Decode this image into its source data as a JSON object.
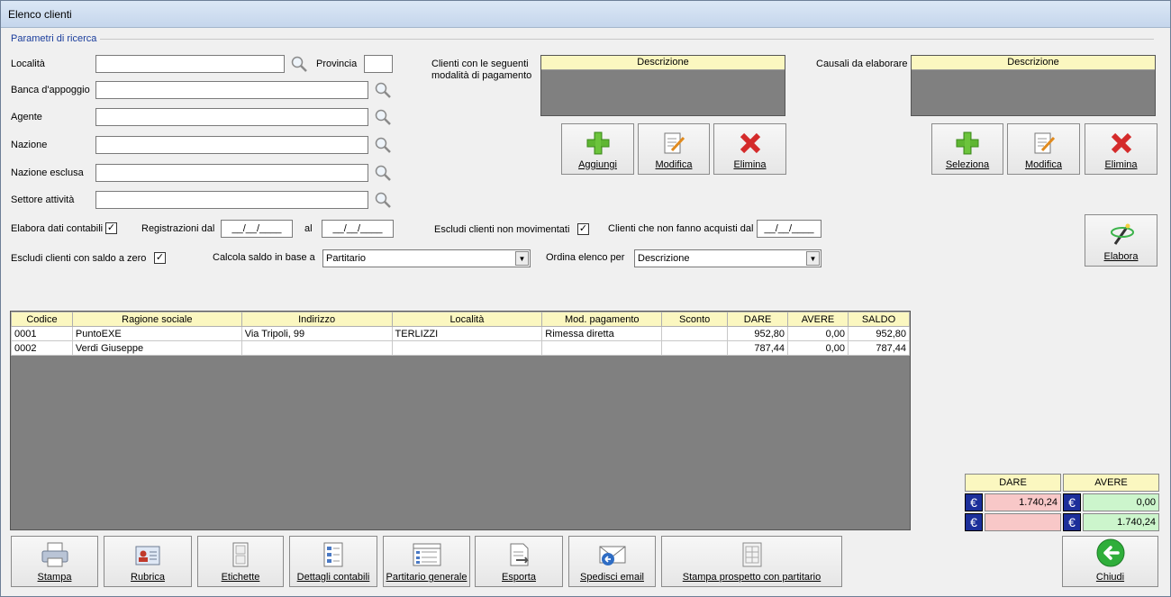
{
  "window": {
    "title": "Elenco clienti"
  },
  "search": {
    "section_label": "Parametri di ricerca",
    "localita_label": "Località",
    "provincia_label": "Provincia",
    "banca_label": "Banca d'appoggio",
    "agente_label": "Agente",
    "nazione_label": "Nazione",
    "nazione_esclusa_label": "Nazione esclusa",
    "settore_label": "Settore attività",
    "elabora_dati_label": "Elabora dati contabili",
    "registrazioni_dal_label": "Registrazioni dal",
    "al_label": "al",
    "date_dal": "__/__/____",
    "date_al": "__/__/____",
    "escludi_non_mov_label": "Escludi clienti non movimentati",
    "non_acquisti_label": "Clienti che non fanno acquisti dal",
    "date_acquisti": "__/__/____",
    "escludi_saldo_zero_label": "Escludi clienti con saldo a zero",
    "calcola_saldo_label": "Calcola saldo in base a",
    "calcola_saldo_value": "Partitario",
    "ordina_label": "Ordina elenco per",
    "ordina_value": "Descrizione",
    "check_mark": "✓"
  },
  "payment": {
    "label_line1": "Clienti con le seguenti",
    "label_line2": "modalità di pagamento",
    "col_descrizione": "Descrizione",
    "btn_aggiungi": "Aggiungi",
    "btn_modifica": "Modifica",
    "btn_elimina": "Elimina"
  },
  "causali": {
    "label": "Causali da elaborare",
    "col_descrizione": "Descrizione",
    "btn_seleziona": "Seleziona",
    "btn_modifica": "Modifica",
    "btn_elimina": "Elimina"
  },
  "elabora_button": "Elabora",
  "table": {
    "columns": [
      "Codice",
      "Ragione sociale",
      "Indirizzo",
      "Località",
      "Mod. pagamento",
      "Sconto",
      "DARE",
      "AVERE",
      "SALDO"
    ],
    "rows": [
      [
        "0001",
        "PuntoEXE",
        "Via Tripoli, 99",
        "TERLIZZI",
        "Rimessa diretta",
        "",
        "952,80",
        "0,00",
        "952,80"
      ],
      [
        "0002",
        "Verdi Giuseppe",
        "",
        "",
        "",
        "",
        "787,44",
        "0,00",
        "787,44"
      ]
    ]
  },
  "totals": {
    "dare_label": "DARE",
    "avere_label": "AVERE",
    "currency_symbol": "€",
    "dare_row1": "1.740,24",
    "avere_row1": "0,00",
    "dare_row2": "",
    "avere_row2": "1.740,24",
    "dare_color": "#f8c8c8",
    "avere_color": "#ccf5cc"
  },
  "toolbar": {
    "stampa": "Stampa",
    "rubrica": "Rubrica",
    "etichette": "Etichette",
    "dettagli": "Dettagli contabili",
    "partitario": "Partitario generale",
    "esporta": "Esporta",
    "email": "Spedisci email",
    "prospetto": "Stampa prospetto con partitario",
    "chiudi": "Chiudi"
  }
}
